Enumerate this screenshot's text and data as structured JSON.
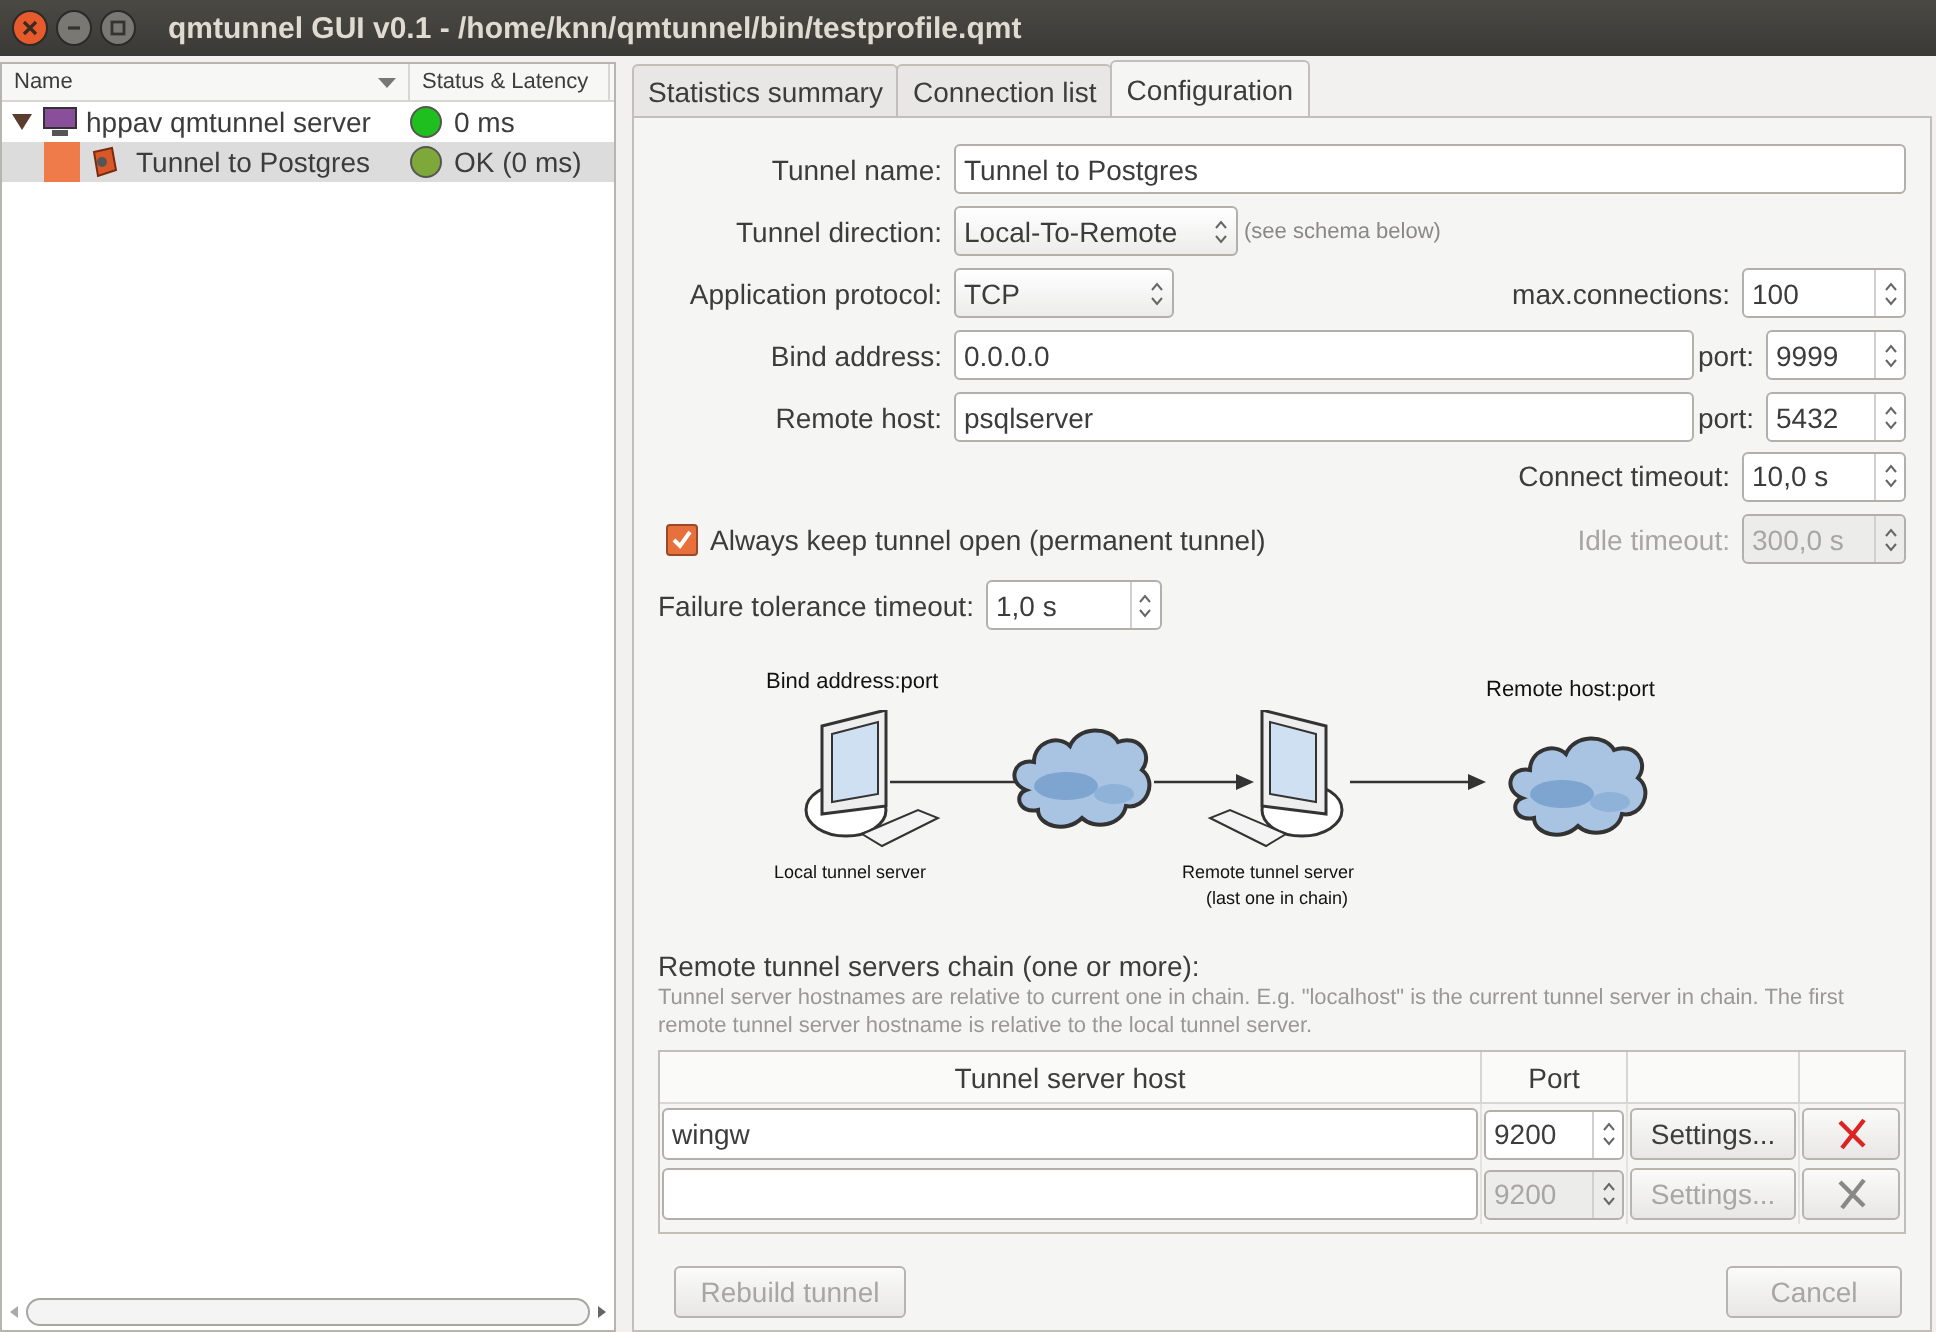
{
  "window": {
    "title": "qmtunnel GUI v0.1 - /home/knn/qmtunnel/bin/testprofile.qmt"
  },
  "tree": {
    "columns": [
      "Name",
      "Status & Latency"
    ],
    "items": [
      {
        "label": "hppav qmtunnel server",
        "status": "0 ms",
        "color": "#1fbf1f",
        "expanded": true,
        "selected": false,
        "children": [
          {
            "label": "Tunnel to Postgres",
            "status": "OK (0 ms)",
            "color": "#7fa83a",
            "selected": true
          }
        ]
      }
    ]
  },
  "tabs": [
    {
      "label": "Statistics summary",
      "selected": false
    },
    {
      "label": "Connection list",
      "selected": false
    },
    {
      "label": "Configuration",
      "selected": true
    }
  ],
  "config": {
    "tunnel_name": {
      "label": "Tunnel name:",
      "value": "Tunnel to Postgres"
    },
    "tunnel_direction": {
      "label": "Tunnel direction:",
      "value": "Local-To-Remote",
      "hint": "(see schema below)"
    },
    "application_protocol": {
      "label": "Application protocol:",
      "value": "TCP"
    },
    "max_connections": {
      "label": "max.connections:",
      "value": "100"
    },
    "bind_address": {
      "label": "Bind address:",
      "value": "0.0.0.0",
      "port_label": "port:",
      "port": "9999"
    },
    "remote_host": {
      "label": "Remote host:",
      "value": "psqlserver",
      "port_label": "port:",
      "port": "5432"
    },
    "connect_timeout": {
      "label": "Connect timeout:",
      "value": "10,0 s"
    },
    "permanent": {
      "label": "Always keep tunnel open (permanent tunnel)",
      "checked": true
    },
    "idle_timeout": {
      "label": "Idle timeout:",
      "value": "300,0 s",
      "disabled": true
    },
    "failure_timeout": {
      "label": "Failure tolerance timeout:",
      "value": "1,0 s"
    }
  },
  "diagram": {
    "bind_label": "Bind address:port",
    "remote_label": "Remote host:port",
    "local_server": "Local tunnel server",
    "remote_server": "Remote tunnel server",
    "remote_server_note": "(last one in chain)"
  },
  "chain": {
    "title": "Remote tunnel servers chain (one or more):",
    "note": "Tunnel server hostnames are relative to current one in chain. E.g. \"localhost\" is the current tunnel server in chain. The first remote tunnel server hostname is relative to the local tunnel server.",
    "columns": [
      "Tunnel server host",
      "Port"
    ],
    "rows": [
      {
        "host": "wingw",
        "port": "9200",
        "settings": "Settings...",
        "disabled": false
      },
      {
        "port": "9200",
        "settings": "Settings...",
        "disabled": true
      }
    ]
  },
  "buttons": [
    {
      "label": "Rebuild tunnel",
      "disabled": true
    },
    {
      "label": "Cancel",
      "disabled": true
    }
  ]
}
